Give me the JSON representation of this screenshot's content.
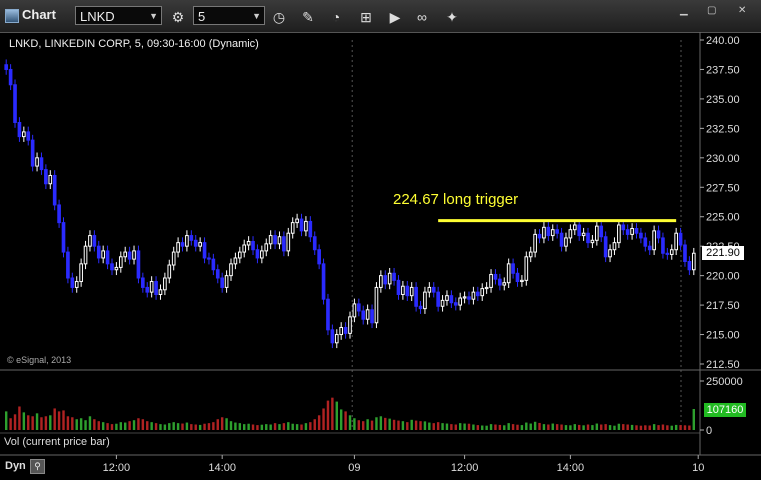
{
  "app": {
    "title": "Chart",
    "symbol": "LNKD",
    "interval": "5"
  },
  "toolbar_icons": [
    "cycle-icon",
    "clock-icon",
    "pencil-icon",
    "chart-style-icon",
    "cursor-icon",
    "play-icon",
    "link-icon"
  ],
  "window_controls": [
    "minimize",
    "maximize",
    "close"
  ],
  "chart_data": {
    "type": "candlestick",
    "title": "LNKD, LINKEDIN CORP, 5, 09:30-16:00 (Dynamic)",
    "copyright": "© eSignal, 2013",
    "annotation": "224.67 long trigger",
    "trigger_level": 224.67,
    "last_price": "221.90",
    "price_ticks": [
      "240.00",
      "237.50",
      "235.00",
      "232.50",
      "230.00",
      "227.50",
      "225.00",
      "222.50",
      "220.00",
      "217.50",
      "215.00",
      "212.50"
    ],
    "ylim": [
      212.5,
      240.0
    ],
    "x_ticks": [
      "12:00",
      "14:00",
      "09",
      "12:00",
      "14:00",
      "10"
    ],
    "x_tick_index": [
      25,
      49,
      79,
      104,
      128,
      157
    ],
    "day_break_index": 79,
    "closes": [
      237.5,
      236.2,
      233.0,
      231.8,
      232.2,
      231.5,
      229.3,
      230.0,
      229.0,
      227.8,
      228.5,
      226.0,
      224.5,
      222.0,
      219.8,
      219.0,
      219.5,
      221.0,
      222.5,
      223.4,
      222.5,
      221.5,
      222.1,
      221.0,
      220.5,
      220.7,
      221.6,
      222.0,
      221.4,
      222.1,
      219.8,
      219.0,
      218.6,
      219.5,
      218.4,
      218.8,
      219.8,
      220.9,
      222.0,
      222.8,
      222.5,
      223.4,
      223.0,
      222.5,
      222.8,
      221.5,
      221.4,
      220.5,
      219.8,
      219.0,
      220.0,
      221.0,
      221.5,
      222.0,
      222.6,
      222.9,
      222.2,
      221.5,
      222.1,
      222.7,
      223.4,
      222.7,
      223.3,
      222.1,
      223.6,
      224.5,
      224.8,
      223.8,
      224.6,
      223.3,
      222.2,
      221.0,
      218.0,
      215.4,
      214.3,
      215.0,
      215.6,
      215.1,
      216.5,
      217.6,
      217.0,
      216.3,
      217.1,
      216.0,
      219.0,
      220.0,
      219.3,
      220.2,
      219.6,
      218.4,
      219.1,
      218.3,
      219.0,
      217.4,
      217.2,
      218.6,
      219.0,
      218.6,
      217.4,
      217.9,
      218.3,
      217.7,
      217.5,
      218.1,
      218.2,
      218.0,
      218.6,
      218.3,
      218.9,
      219.0,
      220.1,
      219.7,
      219.2,
      219.4,
      221.0,
      220.2,
      219.5,
      219.6,
      221.6,
      222.0,
      223.5,
      223.2,
      224.1,
      223.4,
      223.9,
      223.6,
      222.5,
      223.2,
      223.9,
      224.3,
      223.4,
      223.6,
      222.8,
      223.0,
      224.2,
      223.3,
      221.6,
      222.2,
      222.8,
      224.3,
      223.9,
      223.5,
      224.0,
      223.6,
      223.2,
      222.5,
      222.2,
      223.8,
      223.2,
      221.9,
      221.8,
      222.2,
      223.6,
      222.6,
      221.2,
      220.5,
      221.9
    ],
    "volume_max": 250000,
    "volume_ticks": [
      "250000",
      "0"
    ],
    "volume_label": "Vol (current price bar)",
    "last_volume": "107160",
    "volumes": [
      95000,
      60000,
      80000,
      120000,
      90000,
      75000,
      70000,
      85000,
      65000,
      70000,
      75000,
      110000,
      95000,
      100000,
      70000,
      65000,
      55000,
      60000,
      50000,
      70000,
      55000,
      45000,
      40000,
      35000,
      30000,
      32000,
      40000,
      38000,
      45000,
      50000,
      60000,
      55000,
      45000,
      40000,
      35000,
      30000,
      28000,
      35000,
      40000,
      35000,
      33000,
      38000,
      30000,
      28000,
      26000,
      32000,
      35000,
      40000,
      55000,
      65000,
      60000,
      45000,
      38000,
      35000,
      30000,
      32000,
      28000,
      25000,
      27000,
      30000,
      28000,
      35000,
      30000,
      35000,
      40000,
      32000,
      30000,
      28000,
      35000,
      40000,
      55000,
      75000,
      110000,
      150000,
      165000,
      145000,
      105000,
      95000,
      75000,
      60000,
      50000,
      45000,
      55000,
      48000,
      65000,
      70000,
      62000,
      58000,
      52000,
      48000,
      45000,
      40000,
      52000,
      48000,
      45000,
      44000,
      38000,
      35000,
      40000,
      35000,
      33000,
      30000,
      28000,
      35000,
      33000,
      32000,
      28000,
      25000,
      23000,
      22000,
      30000,
      28000,
      26000,
      24000,
      35000,
      30000,
      27000,
      25000,
      38000,
      33000,
      42000,
      36000,
      30000,
      28000,
      33000,
      30000,
      28000,
      25000,
      24000,
      30000,
      26000,
      24000,
      28000,
      25000,
      33000,
      28000,
      30000,
      25000,
      22000,
      32000,
      30000,
      28000,
      26000,
      24000,
      22000,
      24000,
      23000,
      30000,
      25000,
      28000,
      24000,
      22000,
      26000,
      25000,
      24000,
      23000,
      107160
    ],
    "colors": {
      "up": "#ffffff",
      "down": "#2b2bff",
      "trigger": "#ffff33",
      "vol_up": "#2ea02e",
      "vol_down": "#b02222"
    }
  },
  "footer": {
    "dyn_label": "Dyn"
  }
}
